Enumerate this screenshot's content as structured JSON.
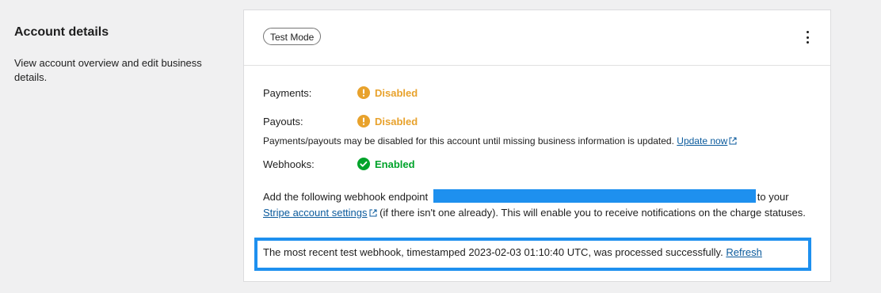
{
  "section": {
    "title": "Account details",
    "description": "View account overview and edit business details."
  },
  "card": {
    "mode_badge": "Test Mode",
    "menu_icon": "more-vertical-icon",
    "statuses": [
      {
        "label": "Payments:",
        "value": "Disabled",
        "icon": "warning-icon",
        "color": "#e8a22c"
      },
      {
        "label": "Payouts:",
        "value": "Disabled",
        "icon": "warning-icon",
        "color": "#e8a22c"
      },
      {
        "label": "Webhooks:",
        "value": "Enabled",
        "icon": "check-circle-icon",
        "color": "#00a32a"
      }
    ],
    "info": {
      "text": "Payments/payouts may be disabled for this account until missing business information is updated.",
      "link_label": "Update now"
    },
    "webhook": {
      "prefix": "Add the following webhook endpoint",
      "suffix": "to your",
      "link_label": "Stripe account settings",
      "rest": "(if there isn't one already). This will enable you to receive notifications on the charge statuses."
    },
    "recent": {
      "text": "The most recent test webhook, timestamped 2023-02-03 01:10:40 UTC, was processed successfully.",
      "refresh_label": "Refresh"
    }
  },
  "colors": {
    "accent_blue": "#1e90ef",
    "link": "#0a5a9c",
    "warning": "#e8a22c",
    "success": "#00a32a"
  }
}
